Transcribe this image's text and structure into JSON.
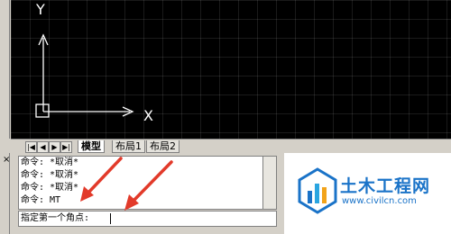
{
  "viewport": {
    "y_axis_label": "Y",
    "x_axis_label": "X"
  },
  "layout_tabs": {
    "nav": [
      "|◀",
      "◀",
      "▶",
      "▶|"
    ],
    "tabs": [
      "模型",
      "布局1",
      "布局2"
    ],
    "active": "模型"
  },
  "command_window": {
    "close_glyph": "×",
    "history": [
      "命令: *取消*",
      "命令: *取消*",
      "命令: *取消*",
      "命令: MT"
    ],
    "prompt": "指定第一个角点:"
  },
  "annotation": {
    "arrow_color": "#e23a2a"
  },
  "watermark": {
    "title": "土木工程网",
    "url": "www.civilcn.com"
  }
}
